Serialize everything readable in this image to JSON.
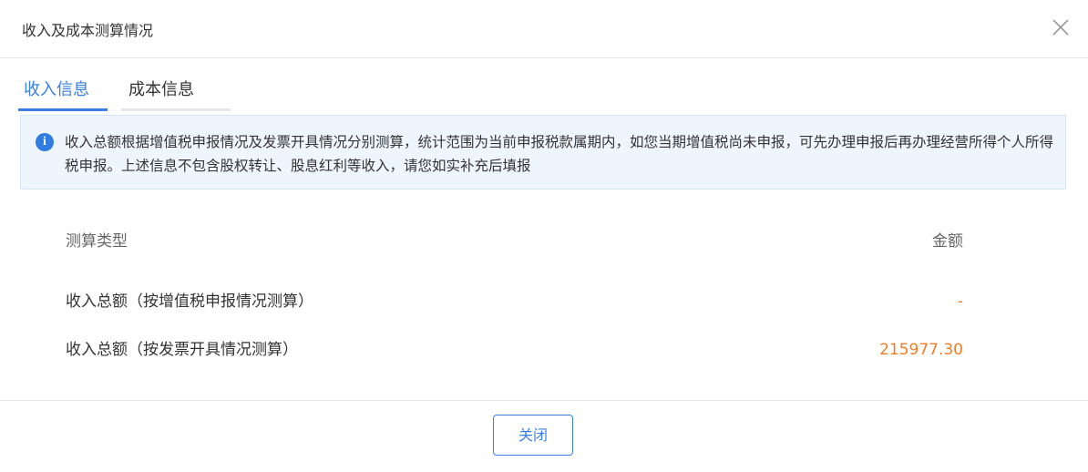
{
  "dialog": {
    "title": "收入及成本测算情况",
    "close_icon": "close-icon"
  },
  "tabs": [
    {
      "label": "收入信息",
      "active": true
    },
    {
      "label": "成本信息",
      "active": false
    }
  ],
  "notice": {
    "icon": "info-icon",
    "icon_glyph": "i",
    "text": "收入总额根据增值税申报情况及发票开具情况分别测算，统计范围为当前申报税款属期内，如您当期增值税尚未申报，可先办理申报后再办理经营所得个人所得税申报。上述信息不包含股权转让、股息红利等收入，请您如实补充后填报"
  },
  "table": {
    "headers": {
      "type": "测算类型",
      "amount": "金额"
    },
    "rows": [
      {
        "type": "收入总额（按增值税申报情况测算）",
        "amount": "-"
      },
      {
        "type": "收入总额（按发票开具情况测算）",
        "amount": "215977.30"
      }
    ]
  },
  "footer": {
    "close_button": "关闭"
  },
  "colors": {
    "accent": "#3a7fe6",
    "amount": "#f27c22",
    "notice_bg": "#eef5fd"
  }
}
